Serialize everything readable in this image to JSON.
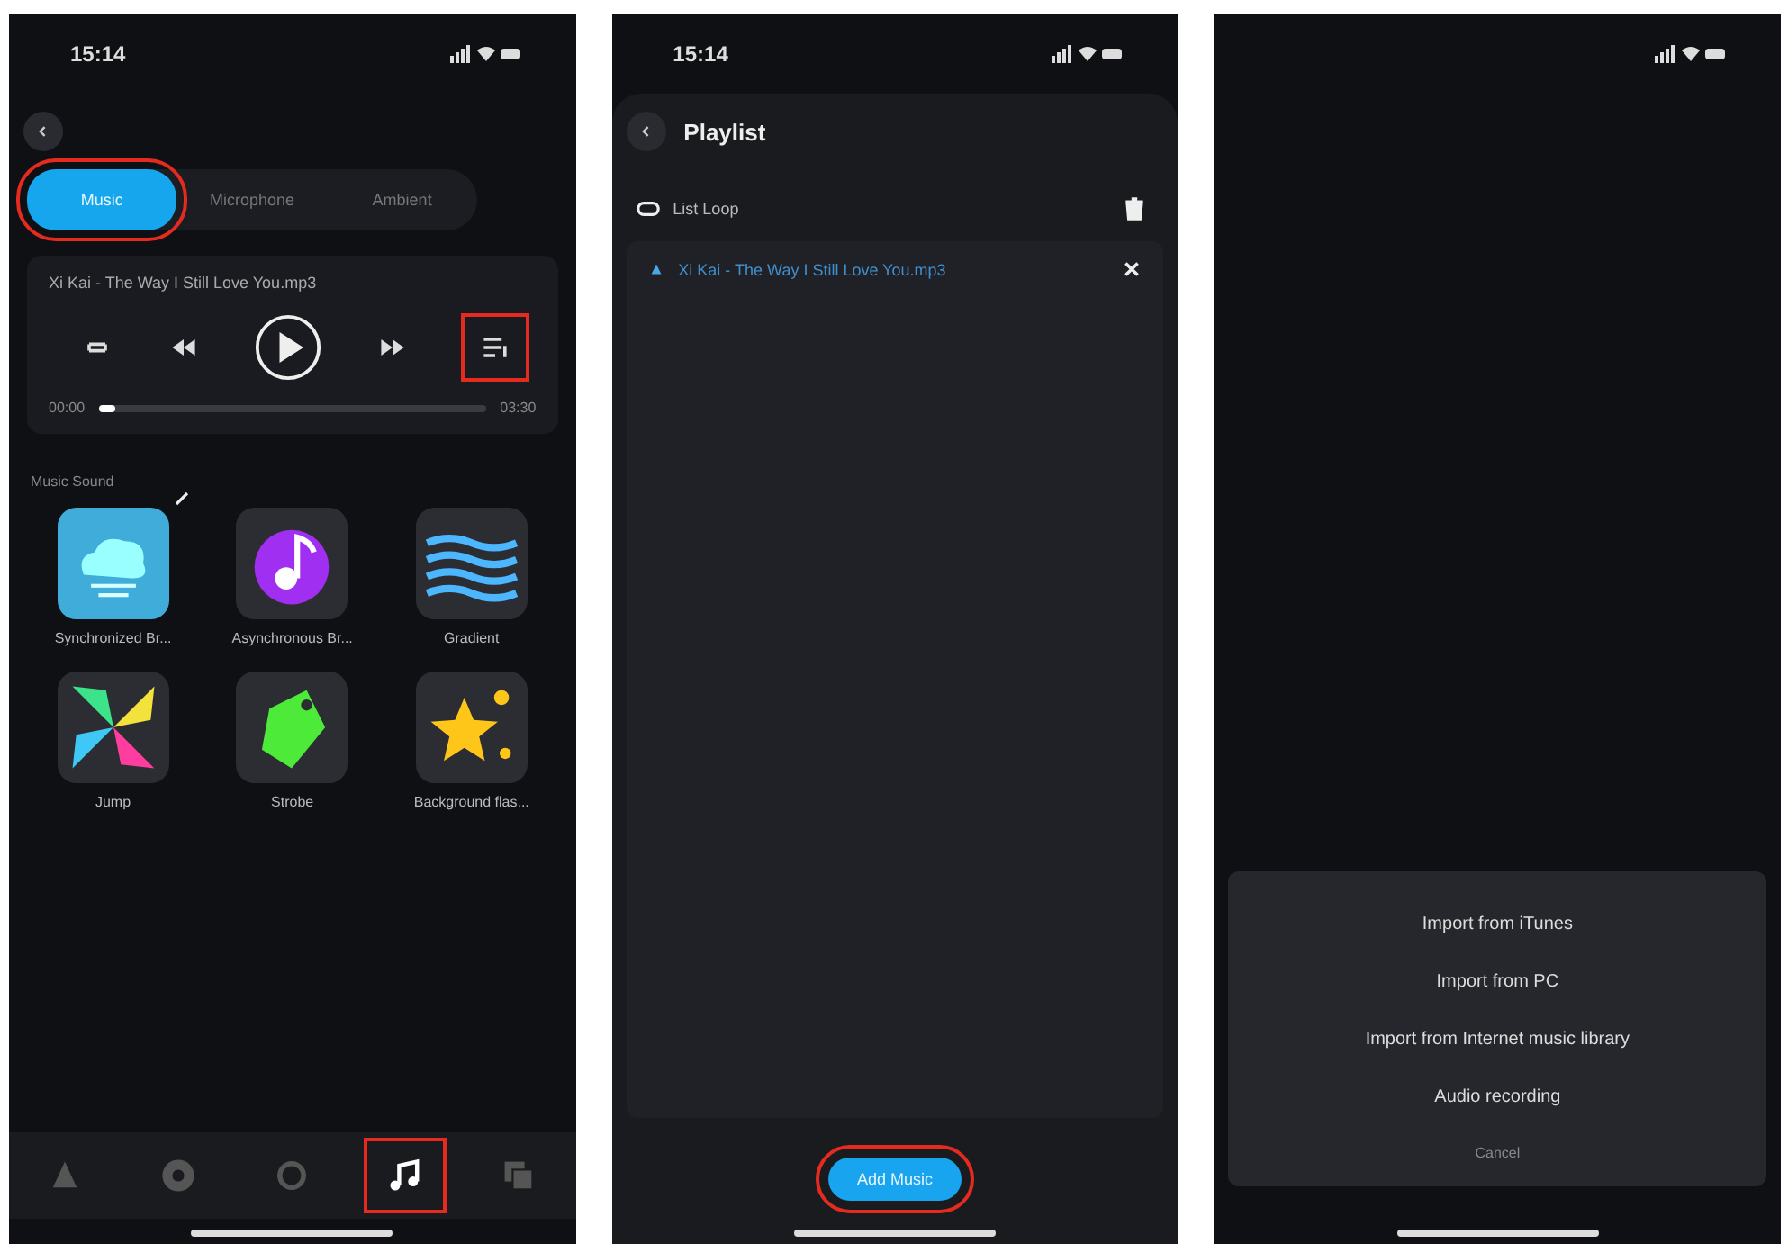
{
  "screens": [
    {
      "kind": "player",
      "status_time": "15:14",
      "tabs": [
        {
          "label": "Music",
          "selected": true,
          "highlighted": true
        },
        {
          "label": "Microphone",
          "selected": false,
          "highlighted": false
        },
        {
          "label": "Ambient",
          "selected": false,
          "highlighted": false
        }
      ],
      "player": {
        "track": "Xi Kai - The Way I Still Love You.mp3",
        "elapsed": "00:00",
        "total": "03:30",
        "level": 0.04,
        "playlist_highlighted": true
      },
      "section_label": "Music Sound",
      "tiles": [
        {
          "kind": "cloud",
          "label": "Synchronized Br...",
          "selected": true
        },
        {
          "kind": "note",
          "label": "Asynchronous Br...",
          "selected": false
        },
        {
          "kind": "waves",
          "label": "Gradient",
          "selected": false
        },
        {
          "kind": "pinwheel",
          "label": "Jump",
          "selected": false
        },
        {
          "kind": "tag",
          "label": "Strobe",
          "selected": false
        },
        {
          "kind": "stars",
          "label": "Background flas...",
          "selected": false
        }
      ],
      "nav": [
        {
          "kind": "bell",
          "selected": false,
          "highlighted": false
        },
        {
          "kind": "gear",
          "selected": false,
          "highlighted": false
        },
        {
          "kind": "ring",
          "selected": false,
          "highlighted": false
        },
        {
          "kind": "music",
          "selected": true,
          "highlighted": true
        },
        {
          "kind": "copy",
          "selected": false,
          "highlighted": false
        }
      ]
    },
    {
      "kind": "playlist",
      "status_time": "15:14",
      "title": "Playlist",
      "loop_mode": "List Loop",
      "songs": [
        {
          "title": "Xi Kai - The Way I Still Love You.mp3",
          "selected": true
        }
      ],
      "add_button": {
        "label": "Add Music",
        "highlighted": true
      }
    },
    {
      "kind": "sheet",
      "options": [
        "Import from iTunes",
        "Import from PC",
        "Import from Internet music library",
        "Audio recording"
      ],
      "cancel": "Cancel"
    }
  ]
}
